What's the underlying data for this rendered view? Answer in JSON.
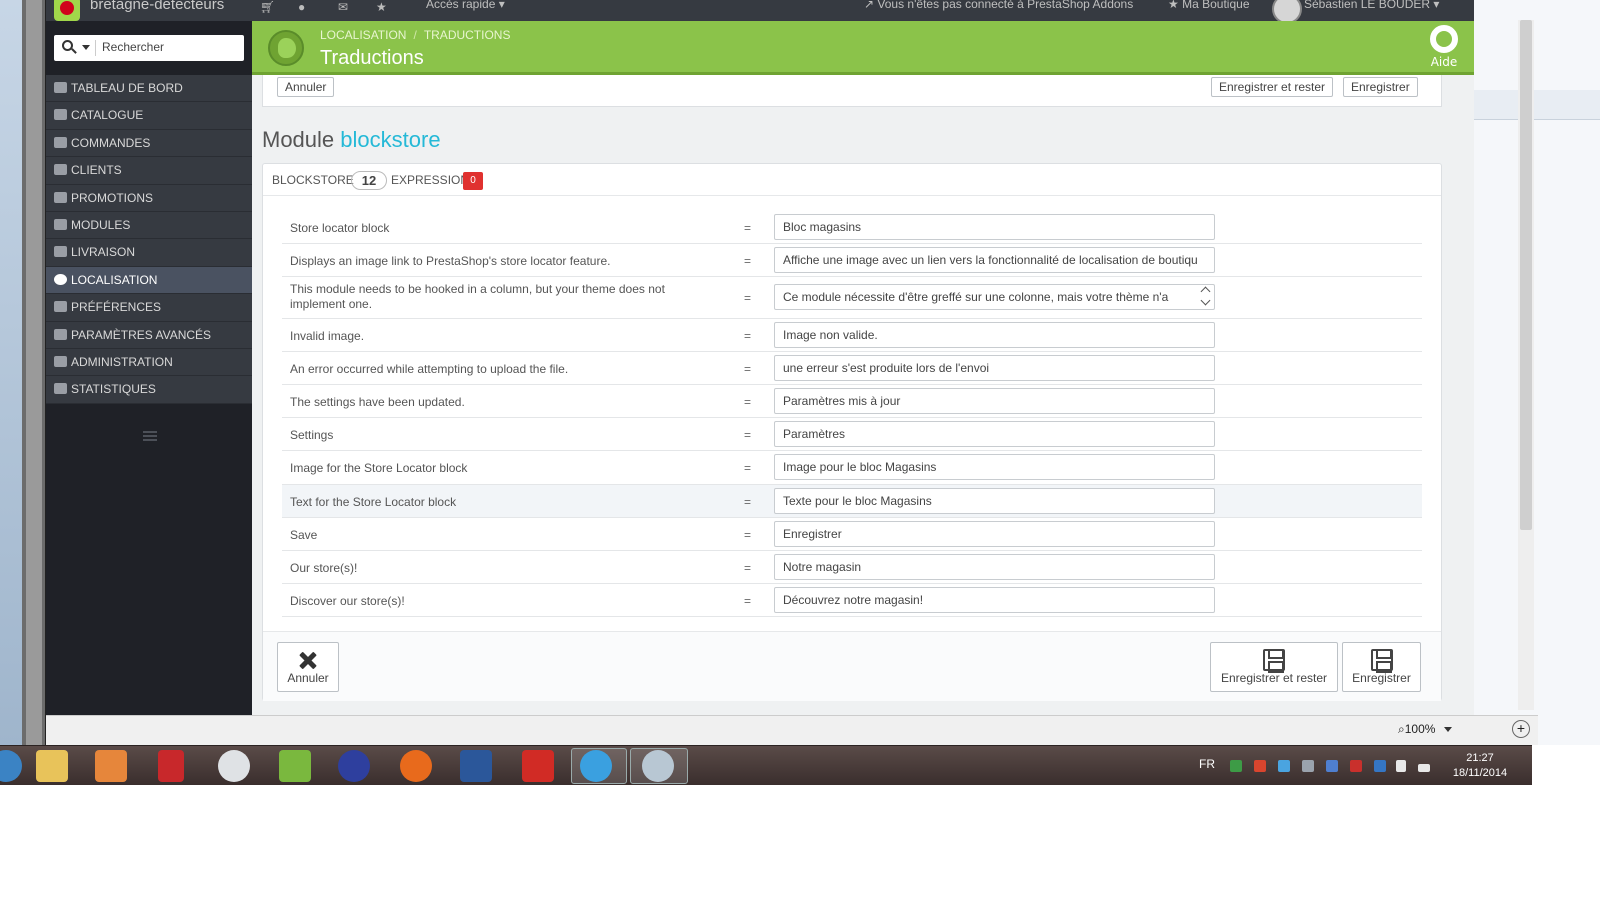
{
  "topbar": {
    "shop_name": "bretagne-detecteurs",
    "quick_access": "Accès rapide",
    "addons_status": "Vous n'êtes pas connecté à PrestaShop Addons",
    "my_shop": "Ma Boutique",
    "user_name": "Sébastien LE BOUDER"
  },
  "header": {
    "breadcrumb": [
      "LOCALISATION",
      "TRADUCTIONS"
    ],
    "title": "Traductions",
    "help_label": "Aide"
  },
  "sidebar": {
    "search_placeholder": "Rechercher",
    "items": [
      {
        "label": "TABLEAU DE BORD",
        "icon": "dashboard-icon"
      },
      {
        "label": "CATALOGUE",
        "icon": "book-icon"
      },
      {
        "label": "COMMANDES",
        "icon": "credit-card-icon"
      },
      {
        "label": "CLIENTS",
        "icon": "users-icon"
      },
      {
        "label": "PROMOTIONS",
        "icon": "tag-icon"
      },
      {
        "label": "MODULES",
        "icon": "puzzle-icon"
      },
      {
        "label": "LIVRAISON",
        "icon": "truck-icon"
      },
      {
        "label": "LOCALISATION",
        "icon": "globe-icon",
        "active": true
      },
      {
        "label": "PRÉFÉRENCES",
        "icon": "wrench-icon"
      },
      {
        "label": "PARAMÈTRES AVANCÉS",
        "icon": "cogs-icon"
      },
      {
        "label": "ADMINISTRATION",
        "icon": "cog-icon"
      },
      {
        "label": "STATISTIQUES",
        "icon": "bar-chart-icon"
      }
    ]
  },
  "actions": {
    "cancel": "Annuler",
    "save_and_stay": "Enregistrer et rester",
    "save": "Enregistrer"
  },
  "module": {
    "prefix": "Module",
    "name": "blockstore"
  },
  "panel": {
    "section_name": "BLOCKSTORE",
    "expression_count": "12",
    "expressions_label": "EXPRESSIONS",
    "missing_count": "0"
  },
  "translations": [
    {
      "source": "Store locator block",
      "value": "Bloc magasins"
    },
    {
      "source": "Displays an image link to PrestaShop's store locator feature.",
      "value": "Affiche une image avec un lien vers la fonctionnalité de localisation de boutiqu"
    },
    {
      "source": "This module needs to be hooked in a column, but your theme does not implement one.",
      "value": "Ce module nécessite d'être greffé sur une colonne, mais votre thème n'a"
    },
    {
      "source": "Invalid image.",
      "value": "Image non valide."
    },
    {
      "source": "An error occurred while attempting to upload the file.",
      "value": "une erreur s'est produite lors de l'envoi"
    },
    {
      "source": "The settings have been updated.",
      "value": "Paramètres mis à jour"
    },
    {
      "source": "Settings",
      "value": "Paramètres"
    },
    {
      "source": "Image for the Store Locator block",
      "value": "Image pour le bloc Magasins"
    },
    {
      "source": "Text for the Store Locator block",
      "value": "Texte pour le bloc Magasins"
    },
    {
      "source": "Save",
      "value": "Enregistrer"
    },
    {
      "source": "Our store(s)!",
      "value": "Notre  magasin"
    },
    {
      "source": "Discover our store(s)!",
      "value": "Découvrez notre magasin!"
    }
  ],
  "equals_sign": "=",
  "browser": {
    "zoom": "100%"
  },
  "taskbar": {
    "language": "FR",
    "time": "21:27",
    "date": "18/11/2014"
  }
}
